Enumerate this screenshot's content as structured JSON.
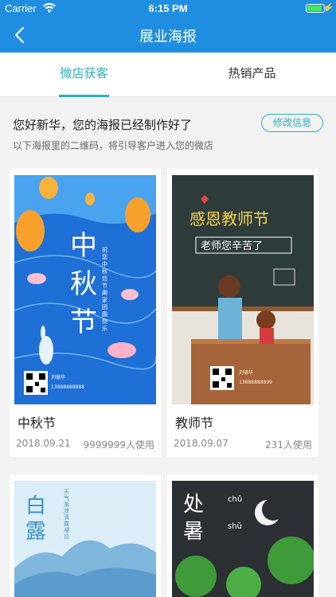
{
  "status_bar": {
    "carrier": "Carrier",
    "time": "6:15 PM",
    "battery_level": 0.9
  },
  "nav": {
    "title": "展业海报",
    "back_icon": "chevron-left-icon"
  },
  "tabs": [
    {
      "label": "微店获客",
      "active": true
    },
    {
      "label": "热销产品",
      "active": false
    }
  ],
  "intro": {
    "greeting": "您好新华，您的海报已经制作好了",
    "edit_button": "修改信息",
    "subtitle": "以下海报里的二维码，将引导客户进入您的微店"
  },
  "posters": [
    {
      "name": "中秋节",
      "date": "2018.09.21",
      "usage": "9999999人使用",
      "art": {
        "headline": "中秋节",
        "side_text": "祝您中秋佳节阖家团圆快乐",
        "agent_name": "刘德华",
        "agent_phone": "13888888888"
      },
      "colors": {
        "sky": "#4aa3ee",
        "sea": "#1e6fd6"
      }
    },
    {
      "name": "教师节",
      "date": "2018.09.07",
      "usage": "231人使用",
      "art": {
        "headline": "感恩教师节",
        "board_text": "老师您辛苦了",
        "agent_name": "刘德华",
        "agent_phone": "13888888899"
      },
      "colors": {
        "board": "#2f3c3c",
        "desk": "#a5643a"
      }
    },
    {
      "name": "白露",
      "art": {
        "headline": "白露",
        "side_text": "天气渐凉清露凝白"
      },
      "colors": {
        "sky": "#dbeef7",
        "cloud": "#7fb6dc"
      }
    },
    {
      "name": "处暑",
      "art": {
        "headline": "处暑",
        "pinyin_top": "chǔ",
        "pinyin_bottom": "shǔ"
      },
      "colors": {
        "sky": "#2c2f33",
        "tree": "#3f9a3a"
      }
    }
  ]
}
